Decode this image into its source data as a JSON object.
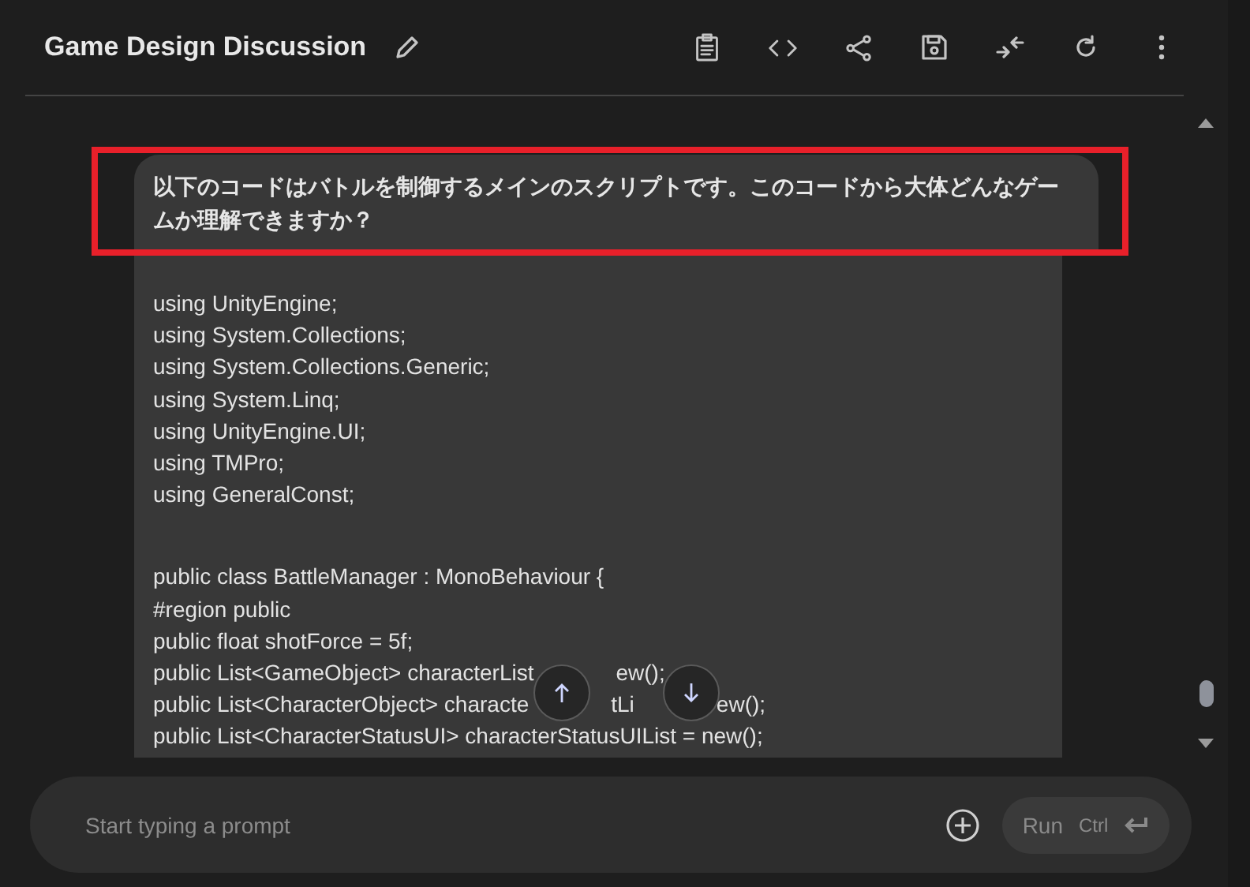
{
  "header": {
    "title": "Game Design Discussion"
  },
  "message": {
    "question": "以下のコードはバトルを制御するメインのスクリプトです。このコードから大体どんなゲームか理解できますか？",
    "code_blocks": [
      [
        [
          "using UnityEngine;"
        ],
        [
          "using System.Collections;"
        ],
        [
          "using System.Collections.Generic;"
        ],
        [
          "using System.Linq;"
        ],
        [
          "using UnityEngine.UI;"
        ],
        [
          "using TMPro;"
        ],
        [
          "using GeneralConst;"
        ]
      ],
      [
        [
          "public class BattleManager : MonoBehaviour {"
        ],
        [
          "#region public"
        ],
        [
          "public float shotForce = 5f;"
        ],
        [
          "public List<GameObject> characterList",
          "ew();"
        ],
        [
          "public List<CharacterObject> characte",
          "tLi",
          "ew();"
        ],
        [
          "public List<CharacterStatusUI> characterStatusUIList = new();"
        ]
      ]
    ]
  },
  "prompt": {
    "placeholder": "Start typing a prompt",
    "run_label": "Run",
    "shortcut": "Ctrl"
  }
}
